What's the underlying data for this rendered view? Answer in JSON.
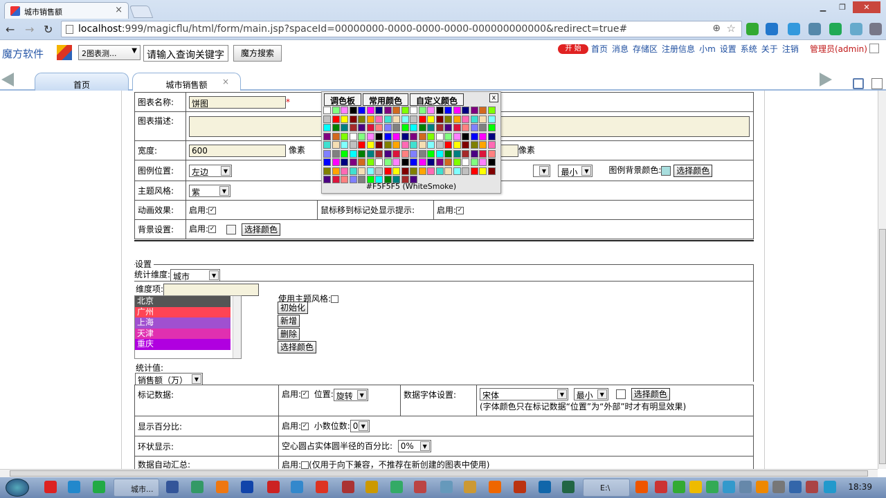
{
  "browser": {
    "tab_title": "城市销售额",
    "url_host": "localhost",
    "url_rest": ":999/magicflu/html/form/main.jsp?spaceId=00000000-0000-0000-0000-000000000000&redirect=true#"
  },
  "header": {
    "logo_text": "魔方软件",
    "chart_select": "2图表测...",
    "search_placeholder": "请输入查询关键字",
    "search_button": "魔方搜索",
    "start_label": "开 始",
    "links": [
      "首页",
      "消息",
      "存储区",
      "注册信息",
      "小m",
      "设置",
      "系统",
      "关于",
      "注销"
    ],
    "admin": "管理员(admin)"
  },
  "tabs": {
    "home": "首页",
    "current": "城市销售额"
  },
  "basic": {
    "name_label": "图表名称:",
    "name_value": "饼图",
    "desc_label": "图表描述:",
    "width_label": "宽度:",
    "width_value": "600",
    "px": "像素",
    "px2": "像素",
    "legend_pos_label": "图例位置:",
    "legend_pos_value": "左边",
    "min_value": "最小",
    "legend_bg_label": "图例背景颜色:",
    "choose_color": "选择颜色",
    "theme_label": "主题风格:",
    "theme_value": "紫",
    "anim_label": "动画效果:",
    "enable": "启用:",
    "hover_label": "鼠标移到标记处显示提示:",
    "bg_label": "背景设置:"
  },
  "settings": {
    "legend": "设置",
    "dim_label": "统计维度:",
    "dim_value": "城市",
    "dim_item_label": "维度项:",
    "cities": [
      {
        "name": "北京",
        "color": "#555555"
      },
      {
        "name": "广州",
        "color": "#ff4455"
      },
      {
        "name": "上海",
        "color": "#a050d0"
      },
      {
        "name": "天津",
        "color": "#e030b0"
      },
      {
        "name": "重庆",
        "color": "#b000e0"
      }
    ],
    "use_theme": "使用主题风格:",
    "btn_init": "初始化",
    "btn_add": "新增",
    "btn_del": "删除",
    "btn_color": "选择颜色",
    "value_label": "统计值:",
    "value_select": "销售额（万）",
    "mark_label": "标记数据:",
    "enable": "启用:",
    "pos_label": "位置:",
    "pos_value": "旋转",
    "font_label": "数据字体设置:",
    "font_value": "宋体",
    "font_size": "最小",
    "choose_color": "选择颜色",
    "font_note": "(字体颜色只在标记数据“位置”为“外部”时才有明显效果)",
    "pct_label": "显示百分比:",
    "decimals_label": "小数位数:",
    "decimals_value": "0",
    "ring_label": "环状显示:",
    "ring_desc": "空心圆占实体圆半径的百分比:",
    "ring_value": "0%",
    "auto_sum_label": "数据自动汇总:",
    "auto_sum_note": "(仅用于向下兼容，不推荐在新创建的图表中使用)"
  },
  "picker": {
    "tabs": [
      "调色板",
      "常用颜色",
      "自定义颜色"
    ],
    "close": "x",
    "value": "#F5F5F5 (WhiteSmoke)"
  },
  "taskbar": {
    "task_browser": "城市...",
    "task_folder": "E:\\",
    "clock": "18:39"
  }
}
